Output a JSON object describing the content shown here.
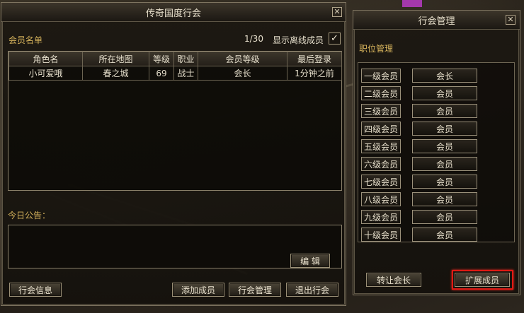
{
  "guild_window": {
    "title": "传奇国度行会",
    "member_list_label": "会员名单",
    "member_count": "1/30",
    "show_offline_label": "显示离线成员",
    "show_offline_checked": "✓",
    "columns": [
      "角色名",
      "所在地图",
      "等级",
      "职业",
      "会员等级",
      "最后登录"
    ],
    "rows": [
      [
        "小可爱哦",
        "春之城",
        "69",
        "战士",
        "会长",
        "1分钟之前"
      ]
    ],
    "notice_label": "今日公告：",
    "edit_button": "编  辑",
    "buttons": {
      "guild_info": "行会信息",
      "add_member": "添加成员",
      "guild_manage": "行会管理",
      "leave_guild": "退出行会"
    },
    "close": "✕"
  },
  "manage_window": {
    "title": "行会管理",
    "section_label": "职位管理",
    "ranks": [
      {
        "name": "一级会员",
        "role": "会长"
      },
      {
        "name": "二级会员",
        "role": "会员"
      },
      {
        "name": "三级会员",
        "role": "会员"
      },
      {
        "name": "四级会员",
        "role": "会员"
      },
      {
        "name": "五级会员",
        "role": "会员"
      },
      {
        "name": "六级会员",
        "role": "会员"
      },
      {
        "name": "七级会员",
        "role": "会员"
      },
      {
        "name": "八级会员",
        "role": "会员"
      },
      {
        "name": "九级会员",
        "role": "会员"
      },
      {
        "name": "十级会员",
        "role": "会员"
      }
    ],
    "buttons": {
      "transfer_leader": "转让会长",
      "expand_members": "扩展成员"
    },
    "close": "✕"
  },
  "colors": {
    "gold_label": "#d6b35c",
    "highlight": "#e01a14"
  }
}
